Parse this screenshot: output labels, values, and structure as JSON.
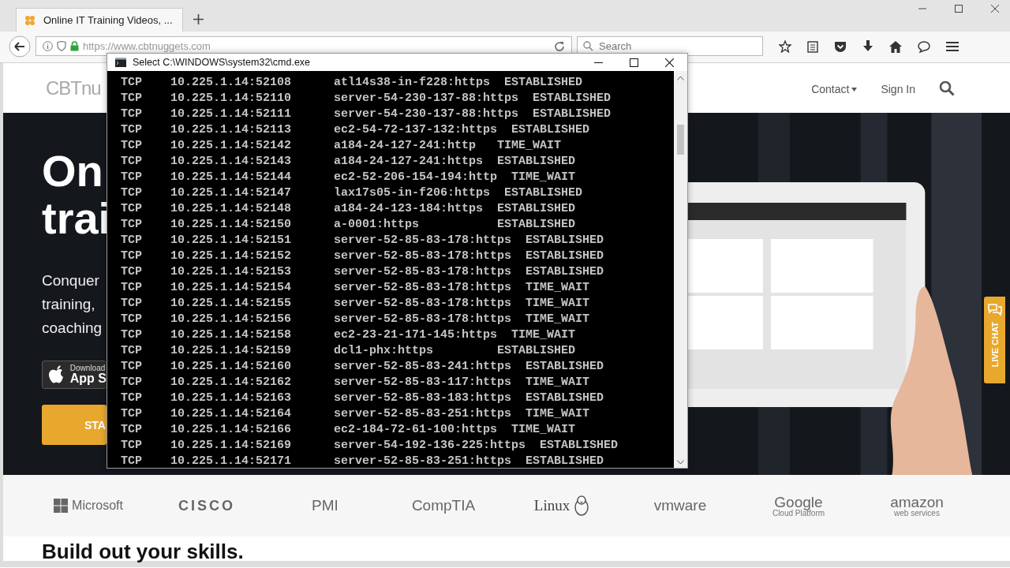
{
  "browser": {
    "tab": {
      "title": "Online IT Training Videos, ...",
      "selected": true
    },
    "url": "https://www.cbtnuggets.com",
    "search": {
      "placeholder": "Search"
    }
  },
  "site": {
    "logo": "CBT**nu**",
    "nav": [
      {
        "label": "Contact",
        "dropdown": true
      },
      {
        "label": "Sign In",
        "dropdown": false
      }
    ],
    "hero": {
      "headline": [
        "On",
        "trai"
      ],
      "lines": [
        "Conquer",
        "training,",
        "coaching"
      ],
      "app_button": {
        "small": "Download",
        "large": "App S"
      },
      "cta": "STA"
    },
    "live_chat": "LIVE CHAT",
    "partners": [
      {
        "name": "Microsoft",
        "kind": "squares"
      },
      {
        "name": "CISCO",
        "kind": "plain"
      },
      {
        "name": "PMI",
        "kind": "plain"
      },
      {
        "name": "CompTIA",
        "kind": "plain"
      },
      {
        "name": "Linux",
        "kind": "penguin"
      },
      {
        "name": "vmware",
        "kind": "plain"
      },
      {
        "name": "Google",
        "subtitle": "Cloud Platform",
        "kind": "stacked"
      },
      {
        "name": "amazon",
        "subtitle": "web services",
        "kind": "stacked"
      }
    ],
    "section_title": "Build out your skills."
  },
  "console": {
    "title": "Select C:\\WINDOWS\\system32\\cmd.exe",
    "rows": [
      {
        "proto": "TCP",
        "local": "10.225.1.14:52108",
        "foreign": "atl14s38-in-f228:https",
        "state": "ESTABLISHED"
      },
      {
        "proto": "TCP",
        "local": "10.225.1.14:52110",
        "foreign": "server-54-230-137-88:https",
        "state": "ESTABLISHED"
      },
      {
        "proto": "TCP",
        "local": "10.225.1.14:52111",
        "foreign": "server-54-230-137-88:https",
        "state": "ESTABLISHED"
      },
      {
        "proto": "TCP",
        "local": "10.225.1.14:52113",
        "foreign": "ec2-54-72-137-132:https",
        "state": "ESTABLISHED"
      },
      {
        "proto": "TCP",
        "local": "10.225.1.14:52142",
        "foreign": "a184-24-127-241:http",
        "state": "TIME_WAIT"
      },
      {
        "proto": "TCP",
        "local": "10.225.1.14:52143",
        "foreign": "a184-24-127-241:https",
        "state": "ESTABLISHED"
      },
      {
        "proto": "TCP",
        "local": "10.225.1.14:52144",
        "foreign": "ec2-52-206-154-194:http",
        "state": "TIME_WAIT"
      },
      {
        "proto": "TCP",
        "local": "10.225.1.14:52147",
        "foreign": "lax17s05-in-f206:https",
        "state": "ESTABLISHED"
      },
      {
        "proto": "TCP",
        "local": "10.225.1.14:52148",
        "foreign": "a184-24-123-184:https",
        "state": "ESTABLISHED"
      },
      {
        "proto": "TCP",
        "local": "10.225.1.14:52150",
        "foreign": "a-0001:https",
        "state": "ESTABLISHED"
      },
      {
        "proto": "TCP",
        "local": "10.225.1.14:52151",
        "foreign": "server-52-85-83-178:https",
        "state": "ESTABLISHED"
      },
      {
        "proto": "TCP",
        "local": "10.225.1.14:52152",
        "foreign": "server-52-85-83-178:https",
        "state": "ESTABLISHED"
      },
      {
        "proto": "TCP",
        "local": "10.225.1.14:52153",
        "foreign": "server-52-85-83-178:https",
        "state": "ESTABLISHED"
      },
      {
        "proto": "TCP",
        "local": "10.225.1.14:52154",
        "foreign": "server-52-85-83-178:https",
        "state": "TIME_WAIT"
      },
      {
        "proto": "TCP",
        "local": "10.225.1.14:52155",
        "foreign": "server-52-85-83-178:https",
        "state": "TIME_WAIT"
      },
      {
        "proto": "TCP",
        "local": "10.225.1.14:52156",
        "foreign": "server-52-85-83-178:https",
        "state": "TIME_WAIT"
      },
      {
        "proto": "TCP",
        "local": "10.225.1.14:52158",
        "foreign": "ec2-23-21-171-145:https",
        "state": "TIME_WAIT"
      },
      {
        "proto": "TCP",
        "local": "10.225.1.14:52159",
        "foreign": "dcl1-phx:https",
        "state": "ESTABLISHED"
      },
      {
        "proto": "TCP",
        "local": "10.225.1.14:52160",
        "foreign": "server-52-85-83-241:https",
        "state": "ESTABLISHED"
      },
      {
        "proto": "TCP",
        "local": "10.225.1.14:52162",
        "foreign": "server-52-85-83-117:https",
        "state": "TIME_WAIT"
      },
      {
        "proto": "TCP",
        "local": "10.225.1.14:52163",
        "foreign": "server-52-85-83-183:https",
        "state": "ESTABLISHED"
      },
      {
        "proto": "TCP",
        "local": "10.225.1.14:52164",
        "foreign": "server-52-85-83-251:https",
        "state": "TIME_WAIT"
      },
      {
        "proto": "TCP",
        "local": "10.225.1.14:52166",
        "foreign": "ec2-184-72-61-100:https",
        "state": "TIME_WAIT"
      },
      {
        "proto": "TCP",
        "local": "10.225.1.14:52169",
        "foreign": "server-54-192-136-225:https",
        "state": "ESTABLISHED"
      },
      {
        "proto": "TCP",
        "local": "10.225.1.14:52171",
        "foreign": "server-52-85-83-251:https",
        "state": "ESTABLISHED"
      }
    ]
  }
}
